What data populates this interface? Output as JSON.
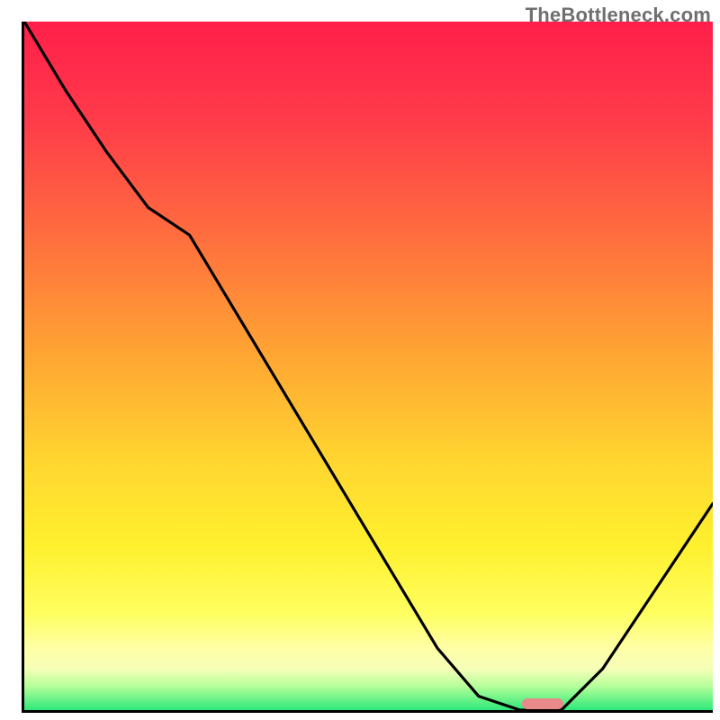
{
  "watermark": "TheBottleneck.com",
  "colors": {
    "axis": "#000000",
    "curve": "#000000",
    "marker": "#e98a8a",
    "gradient_top": "#ff1f4a",
    "gradient_bottom": "#2ee87a"
  },
  "chart_data": {
    "type": "line",
    "title": "",
    "xlabel": "",
    "ylabel": "",
    "x": [
      0.0,
      0.06,
      0.12,
      0.18,
      0.24,
      0.3,
      0.36,
      0.42,
      0.48,
      0.54,
      0.6,
      0.66,
      0.72,
      0.78,
      0.84,
      0.9,
      0.96,
      1.0
    ],
    "values": [
      1.0,
      0.9,
      0.81,
      0.73,
      0.69,
      0.59,
      0.49,
      0.39,
      0.29,
      0.19,
      0.09,
      0.02,
      0.0,
      0.0,
      0.06,
      0.15,
      0.24,
      0.3
    ],
    "xlim": [
      0,
      1
    ],
    "ylim": [
      0,
      1
    ],
    "marker": {
      "x_start": 0.72,
      "x_end": 0.78,
      "y": 0.0
    },
    "note": "Values are fractions of the plot area; x from left axis, y from bottom axis, read approximately from pixels."
  }
}
